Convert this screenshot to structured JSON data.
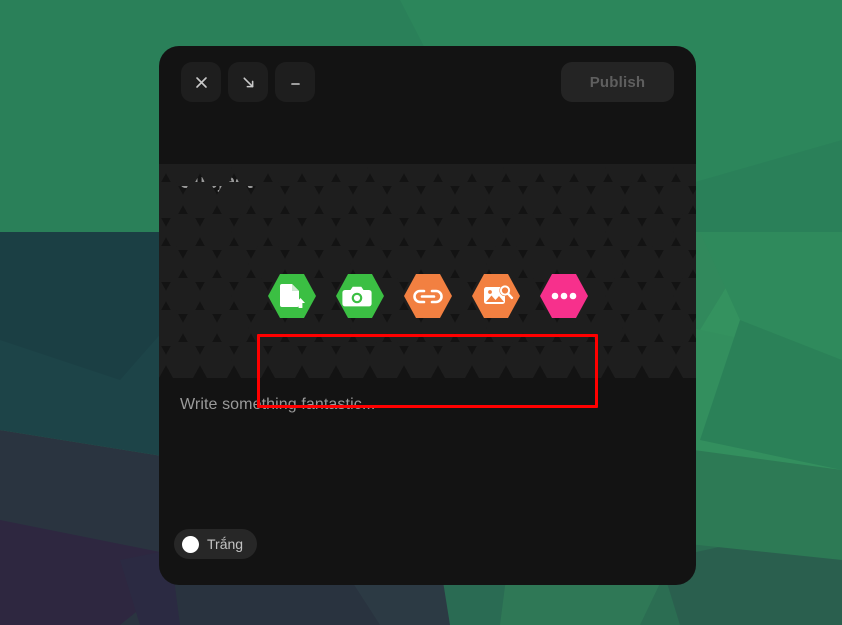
{
  "desktop": {
    "wallpaper_name": "low-poly-green-wallpaper",
    "colors": {
      "green_top": "#2a8059",
      "green_mid": "#34925f",
      "teal_dark": "#1d4447",
      "slate_dark": "#2c3640",
      "purple_dark": "#2e2740"
    }
  },
  "composer": {
    "window_controls": [
      {
        "name": "close",
        "label": "×",
        "icon": "close-icon"
      },
      {
        "name": "expand",
        "label": "↘",
        "icon": "expand-arrow-icon"
      },
      {
        "name": "minimize",
        "label": "—",
        "icon": "minimize-icon"
      }
    ],
    "publish_label": "Publish",
    "publish_enabled": false,
    "subject_placeholder": "Subject",
    "body_placeholder": "Write something fantastic...",
    "toolbar": {
      "highlighted": true,
      "highlight_color": "#ff0000",
      "actions": [
        {
          "name": "attach-file",
          "icon": "file-upload-icon",
          "color": "#3bbf43",
          "tooltip": "Attach file"
        },
        {
          "name": "take-photo",
          "icon": "camera-icon",
          "color": "#3bbf43",
          "tooltip": "Camera"
        },
        {
          "name": "insert-link",
          "icon": "link-icon",
          "color": "#f28041",
          "tooltip": "Insert link"
        },
        {
          "name": "search-image",
          "icon": "image-search-icon",
          "color": "#f28041",
          "tooltip": "Search image"
        },
        {
          "name": "more-options",
          "icon": "ellipsis-icon",
          "color": "#f7308c",
          "tooltip": "More"
        }
      ]
    },
    "status_chip": {
      "label": "Trắng",
      "dot_color": "#ffffff"
    }
  }
}
